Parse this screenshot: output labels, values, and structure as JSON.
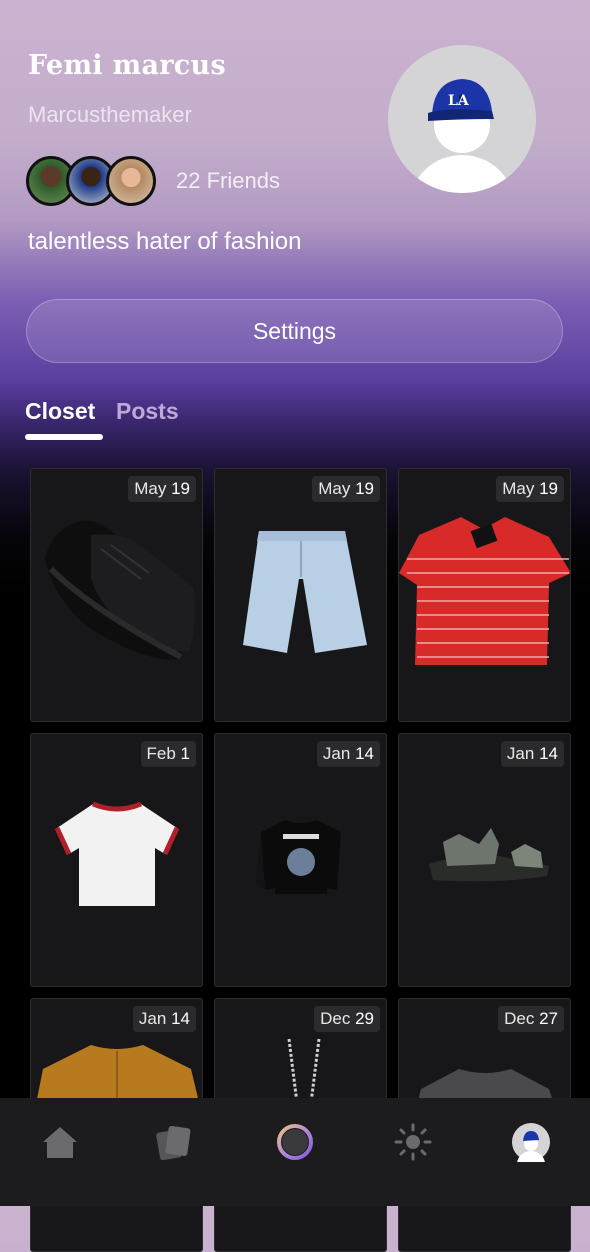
{
  "profile": {
    "name": "Femi marcus",
    "handle": "Marcusthemaker",
    "friends_count": "22",
    "friends_label": "Friends",
    "bio": "talentless hater of fashion"
  },
  "settings_label": "Settings",
  "tabs": [
    {
      "label": "Closet",
      "active": true
    },
    {
      "label": "Posts",
      "active": false
    }
  ],
  "closet": [
    {
      "month": "May",
      "day": "19",
      "item": "black-sneakers"
    },
    {
      "month": "May",
      "day": "19",
      "item": "denim-shorts"
    },
    {
      "month": "May",
      "day": "19",
      "item": "red-striped-polo"
    },
    {
      "month": "Feb",
      "day": "1",
      "item": "white-ringer-tee"
    },
    {
      "month": "Jan",
      "day": "14",
      "item": "black-graphic-sweatshirt"
    },
    {
      "month": "Jan",
      "day": "14",
      "item": "grey-sandals"
    },
    {
      "month": "Jan",
      "day": "14",
      "item": "mustard-shirt"
    },
    {
      "month": "Dec",
      "day": "29",
      "item": "silver-chain"
    },
    {
      "month": "Dec",
      "day": "27",
      "item": "grey-tee"
    }
  ],
  "nav": [
    {
      "icon": "home-icon",
      "active": false
    },
    {
      "icon": "cards-icon",
      "active": false
    },
    {
      "icon": "ring-icon",
      "active": false
    },
    {
      "icon": "sun-icon",
      "active": false
    },
    {
      "icon": "profile-avatar-icon",
      "active": true
    }
  ],
  "colors": {
    "accent": "#5a3fa0",
    "card_bg": "#171719",
    "nav_bg": "#1c1c1e"
  }
}
